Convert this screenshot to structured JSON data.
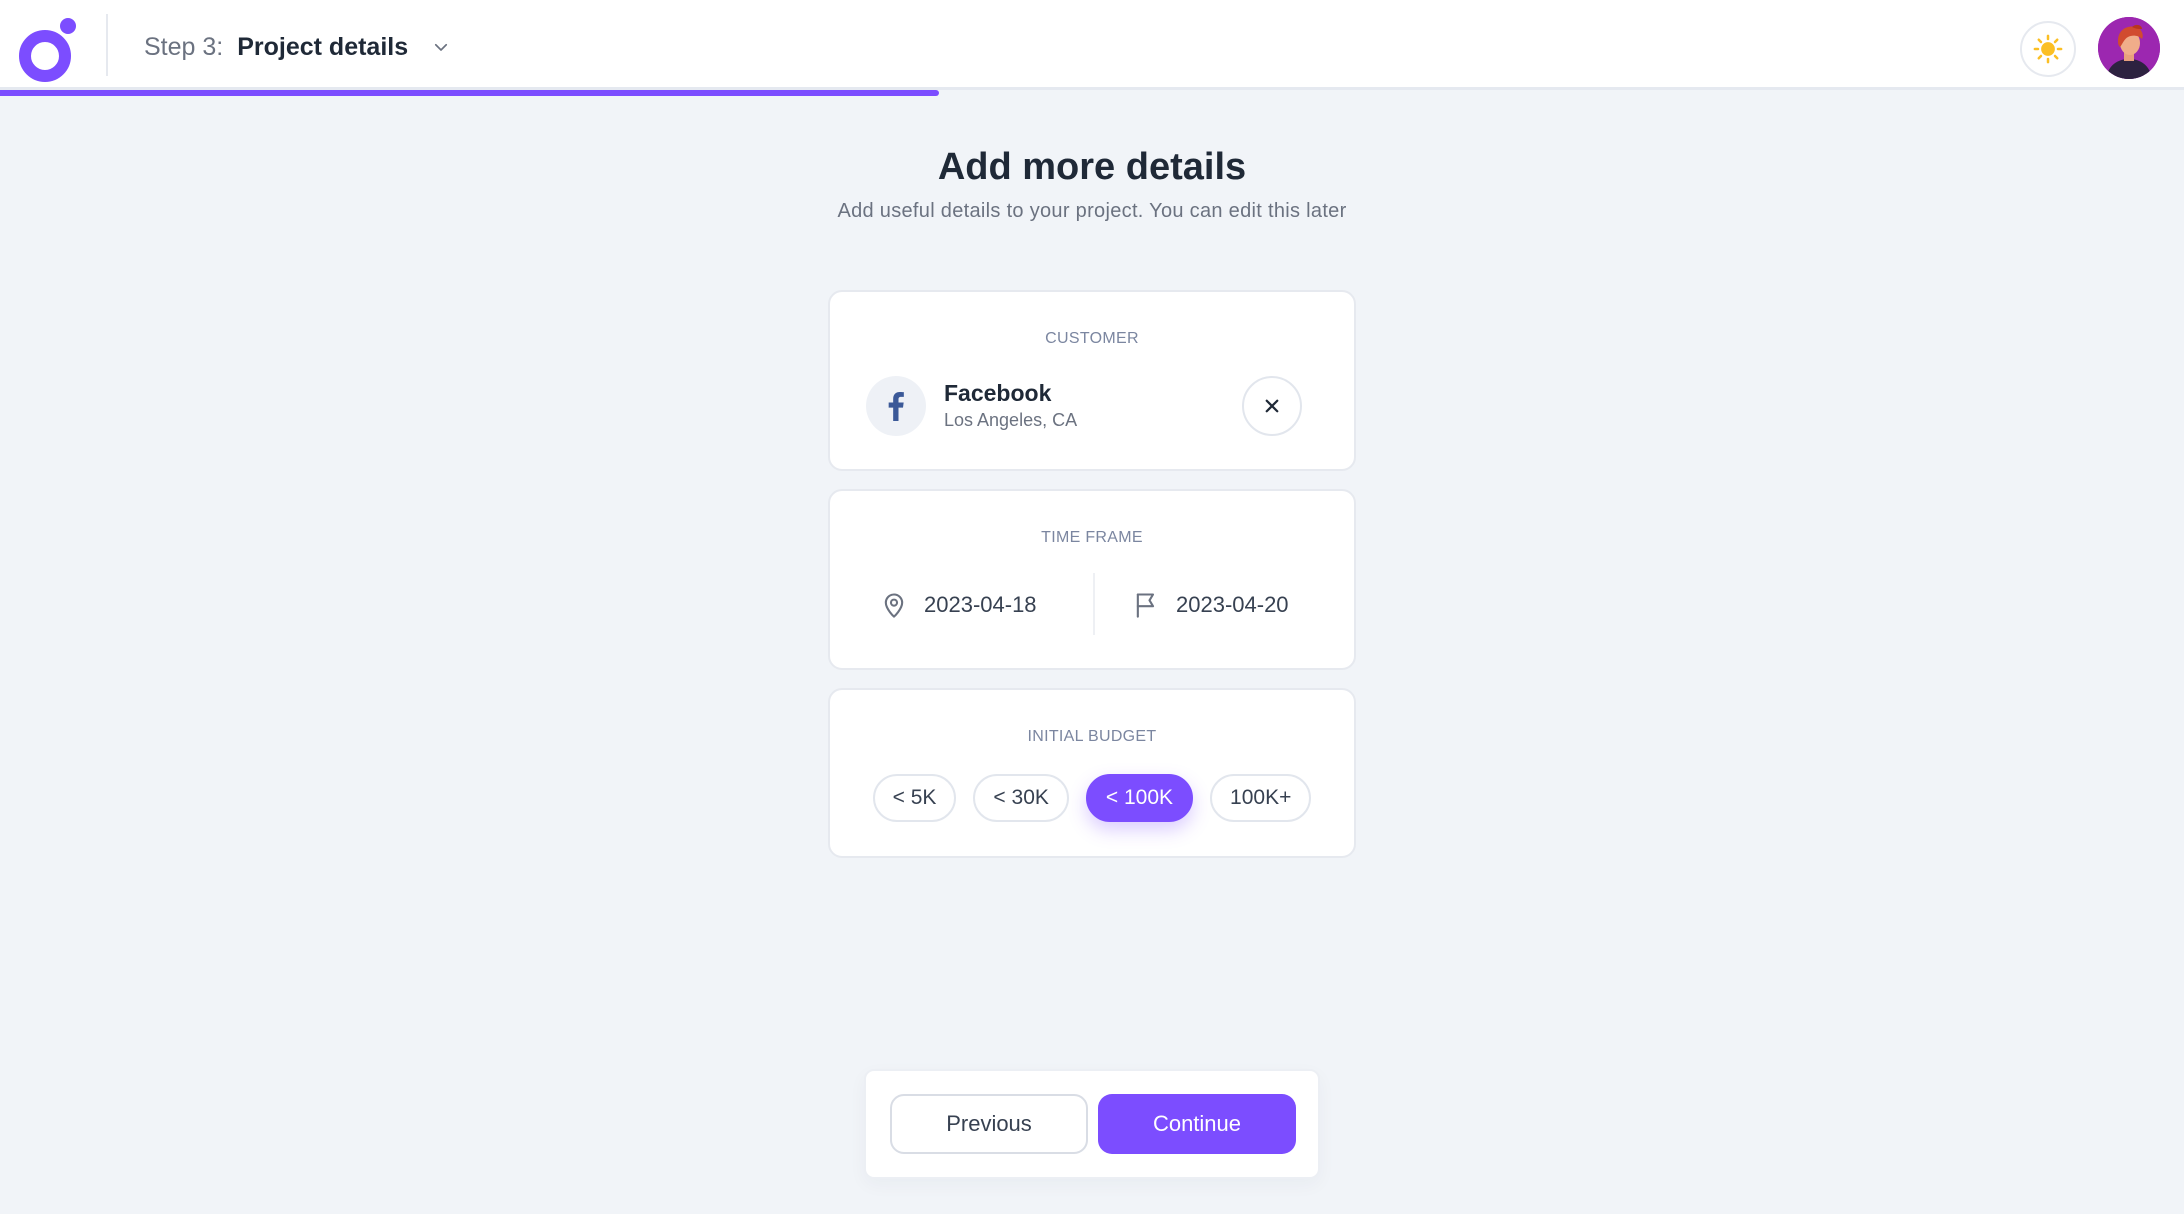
{
  "header": {
    "step_prefix": "Step 3:",
    "step_title": "Project details"
  },
  "main": {
    "title": "Add more details",
    "subtitle": "Add useful details to your project. You can edit this later"
  },
  "customer": {
    "label": "CUSTOMER",
    "name": "Facebook",
    "location": "Los Angeles, CA",
    "logo_icon": "facebook-icon"
  },
  "time_frame": {
    "label": "TIME FRAME",
    "start_date": "2023-04-18",
    "end_date": "2023-04-20"
  },
  "budget": {
    "label": "INITIAL BUDGET",
    "options": [
      "< 5K",
      "< 30K",
      "< 100K",
      "100K+"
    ],
    "selected": "< 100K"
  },
  "footer": {
    "previous_label": "Previous",
    "continue_label": "Continue"
  },
  "progress": {
    "value": 0.43
  },
  "colors": {
    "accent": "#7c4dff",
    "background": "#f1f4f8",
    "facebook": "#3b5998",
    "sun": "#fbbf24"
  }
}
